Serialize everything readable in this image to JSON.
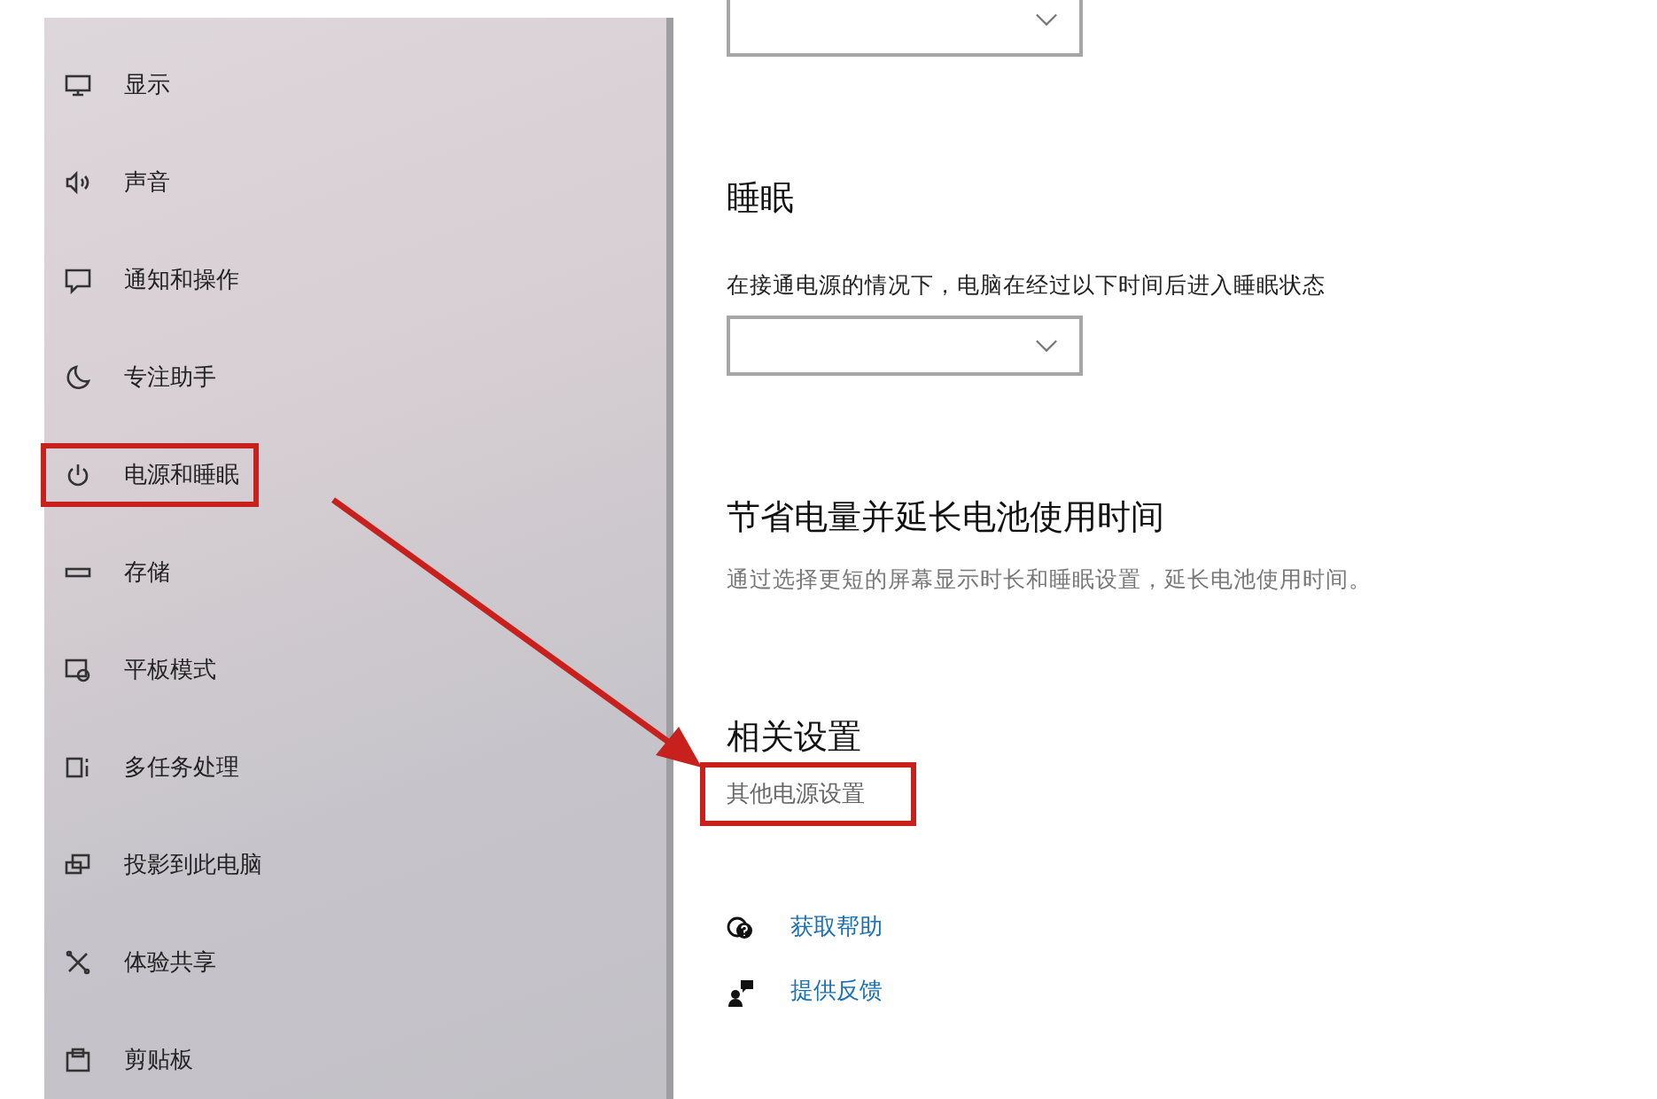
{
  "sidebar": {
    "items": [
      {
        "label": "显示",
        "kind": "display",
        "annotated": false
      },
      {
        "label": "声音",
        "kind": "sound",
        "annotated": false
      },
      {
        "label": "通知和操作",
        "kind": "notifications",
        "annotated": false
      },
      {
        "label": "专注助手",
        "kind": "focus",
        "annotated": false
      },
      {
        "label": "电源和睡眠",
        "kind": "power",
        "annotated": true
      },
      {
        "label": "存储",
        "kind": "storage",
        "annotated": false
      },
      {
        "label": "平板模式",
        "kind": "tablet",
        "annotated": false
      },
      {
        "label": "多任务处理",
        "kind": "multitask",
        "annotated": false
      },
      {
        "label": "投影到此电脑",
        "kind": "project",
        "annotated": false
      },
      {
        "label": "体验共享",
        "kind": "share",
        "annotated": false
      },
      {
        "label": "剪贴板",
        "kind": "clipboard",
        "annotated": false
      }
    ]
  },
  "content": {
    "blocks": [
      {
        "kind": "dropdown",
        "cut": true
      },
      {
        "kind": "heading",
        "text": "睡眠"
      },
      {
        "kind": "label",
        "text": "在接通电源的情况下，电脑在经过以下时间后进入睡眠状态"
      },
      {
        "kind": "dropdown",
        "cut": false
      },
      {
        "kind": "heading",
        "text": "节省电量并延长电池使用时间"
      },
      {
        "kind": "description",
        "text": "通过选择更短的屏幕显示时长和睡眠设置，延长电池使用时间。"
      },
      {
        "kind": "heading",
        "text": "相关设置"
      },
      {
        "kind": "link",
        "text": "其他电源设置",
        "annotated": true
      },
      {
        "kind": "help",
        "text": "获取帮助"
      },
      {
        "kind": "feedback",
        "text": "提供反馈"
      }
    ]
  }
}
